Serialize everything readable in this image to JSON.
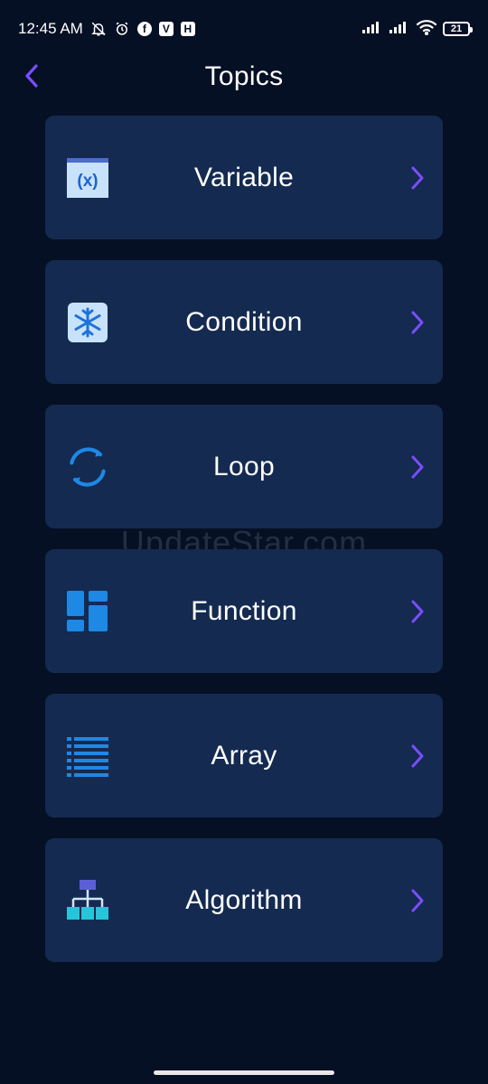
{
  "status_bar": {
    "time": "12:45 AM",
    "battery": "21",
    "icons": [
      "bell-off-icon",
      "alarm-icon",
      "facebook-icon",
      "v-app-icon",
      "h-app-icon",
      "signal-icon",
      "signal-icon",
      "wifi-icon",
      "battery-icon"
    ]
  },
  "header": {
    "title": "Topics",
    "back_icon": "chevron-left-icon"
  },
  "topics": [
    {
      "label": "Variable",
      "icon": "variable-icon"
    },
    {
      "label": "Condition",
      "icon": "snowflake-icon"
    },
    {
      "label": "Loop",
      "icon": "loop-icon"
    },
    {
      "label": "Function",
      "icon": "dashboard-icon"
    },
    {
      "label": "Array",
      "icon": "list-icon"
    },
    {
      "label": "Algorithm",
      "icon": "hierarchy-icon"
    }
  ],
  "watermark": "UpdateStar.com",
  "colors": {
    "background": "#061024",
    "card": "#142a50",
    "accent": "#7b4dff",
    "icon_blue": "#1e88e5"
  }
}
